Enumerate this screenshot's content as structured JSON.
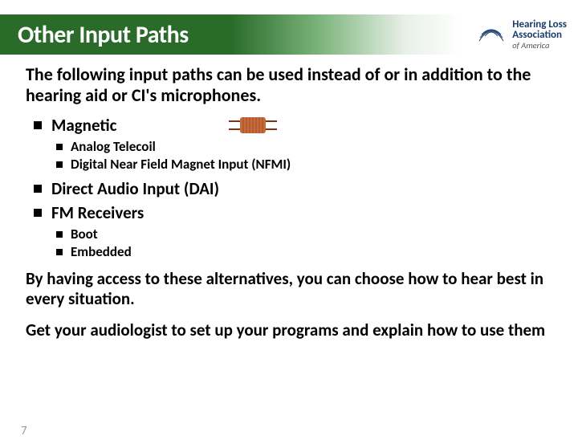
{
  "header": {
    "title": "Other Input Paths"
  },
  "logo": {
    "line1": "Hearing Loss",
    "line2": "Association",
    "line3": "of America"
  },
  "intro": "The following input paths can be used instead of or in addition to the hearing aid or CI's microphones.",
  "bullets": {
    "magnetic": "Magnetic",
    "magnetic_sub1": "Analog Telecoil",
    "magnetic_sub2": "Digital Near Field Magnet Input (NFMI)",
    "dai": "Direct Audio Input (DAI)",
    "fm": "FM Receivers",
    "fm_sub1": "Boot",
    "fm_sub2": "Embedded"
  },
  "closing1": "By having access to these alternatives, you can choose how to hear best in every situation.",
  "closing2": "Get your audiologist to set up your programs and explain how to use them",
  "page_number": "7"
}
